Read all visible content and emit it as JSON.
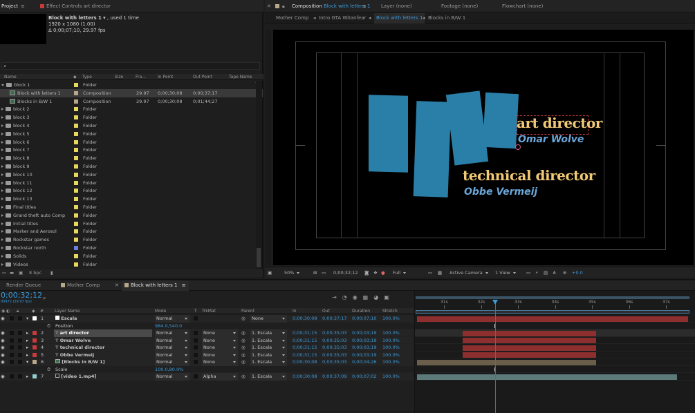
{
  "project_panel": {
    "tab_project": "Project",
    "tab_effect_controls": "Effect Controls art director",
    "comp_name": "Block with letters 1",
    "used": ", used 1 time",
    "dims": "1920 x 1080 (1.00)",
    "duration": "Δ 0;00;07;10, 29.97 fps",
    "search_glyph": "⌕",
    "headers": {
      "name": "Name",
      "type": "Type",
      "size": "Size",
      "fps": "Fra...",
      "in": "In Point",
      "out": "Out Point",
      "tape": "Tape Name"
    },
    "items": [
      {
        "name": "block 1",
        "type": "Folder",
        "color": "#e7d95e",
        "fps": "",
        "in": "",
        "out": "",
        "kind": "folder-open"
      },
      {
        "name": "Block with letters 1",
        "type": "Composition",
        "color": "#b8a88a",
        "fps": "29.97",
        "in": "0;00;30;08",
        "out": "0;00;37;17",
        "kind": "comp"
      },
      {
        "name": "Blocks in B/W 1",
        "type": "Composition",
        "color": "#b8a88a",
        "fps": "29.97",
        "in": "0;00;30;08",
        "out": "0;01;44;27",
        "kind": "comp"
      },
      {
        "name": "block 2",
        "type": "Folder",
        "color": "#e7d95e",
        "fps": "",
        "in": "",
        "out": "",
        "kind": "folder"
      },
      {
        "name": "block 3",
        "type": "Folder",
        "color": "#e7d95e",
        "fps": "",
        "in": "",
        "out": "",
        "kind": "folder"
      },
      {
        "name": "block 4",
        "type": "Folder",
        "color": "#e7d95e",
        "fps": "",
        "in": "",
        "out": "",
        "kind": "folder"
      },
      {
        "name": "block 5",
        "type": "Folder",
        "color": "#e7d95e",
        "fps": "",
        "in": "",
        "out": "",
        "kind": "folder"
      },
      {
        "name": "block 6",
        "type": "Folder",
        "color": "#e7d95e",
        "fps": "",
        "in": "",
        "out": "",
        "kind": "folder"
      },
      {
        "name": "block 7",
        "type": "Folder",
        "color": "#e7d95e",
        "fps": "",
        "in": "",
        "out": "",
        "kind": "folder"
      },
      {
        "name": "block 8",
        "type": "Folder",
        "color": "#e7d95e",
        "fps": "",
        "in": "",
        "out": "",
        "kind": "folder"
      },
      {
        "name": "block 9",
        "type": "Folder",
        "color": "#e7d95e",
        "fps": "",
        "in": "",
        "out": "",
        "kind": "folder"
      },
      {
        "name": "block 10",
        "type": "Folder",
        "color": "#e7d95e",
        "fps": "",
        "in": "",
        "out": "",
        "kind": "folder"
      },
      {
        "name": "block 11",
        "type": "Folder",
        "color": "#e7d95e",
        "fps": "",
        "in": "",
        "out": "",
        "kind": "folder"
      },
      {
        "name": "block 12",
        "type": "Folder",
        "color": "#e7d95e",
        "fps": "",
        "in": "",
        "out": "",
        "kind": "folder"
      },
      {
        "name": "block 13",
        "type": "Folder",
        "color": "#e7d95e",
        "fps": "",
        "in": "",
        "out": "",
        "kind": "folder"
      },
      {
        "name": "Final titles",
        "type": "Folder",
        "color": "#e7d95e",
        "fps": "",
        "in": "",
        "out": "",
        "kind": "folder"
      },
      {
        "name": "Grand theft auto Comp",
        "type": "Folder",
        "color": "#e7d95e",
        "fps": "",
        "in": "",
        "out": "",
        "kind": "folder"
      },
      {
        "name": "Initial titles",
        "type": "Folder",
        "color": "#e7d95e",
        "fps": "",
        "in": "",
        "out": "",
        "kind": "folder"
      },
      {
        "name": "Marker and Aerosol",
        "type": "Folder",
        "color": "#e7d95e",
        "fps": "",
        "in": "",
        "out": "",
        "kind": "folder"
      },
      {
        "name": "Rockstar games",
        "type": "Folder",
        "color": "#e7d95e",
        "fps": "",
        "in": "",
        "out": "",
        "kind": "folder"
      },
      {
        "name": "Rockstar north",
        "type": "Folder",
        "color": "#6b7fe0",
        "fps": "",
        "in": "",
        "out": "",
        "kind": "folder"
      },
      {
        "name": "Solids",
        "type": "Folder",
        "color": "#e7d95e",
        "fps": "",
        "in": "",
        "out": "",
        "kind": "folder"
      },
      {
        "name": "Videos",
        "type": "Folder",
        "color": "#e7d95e",
        "fps": "",
        "in": "",
        "out": "",
        "kind": "folder"
      }
    ],
    "bpc": "8 bpc"
  },
  "comp_panel": {
    "tab_label": "Composition",
    "tab_comp": "Block with letters 1",
    "tab_layer": "Layer (none)",
    "tab_footage": "Footage (none)",
    "tab_flowchart": "Flowchart (none)",
    "subtabs": [
      "Mother Comp",
      "Intro GTA Witanfear",
      "Block with letters 1",
      "Blocks in B/W 1"
    ],
    "title1": "art director",
    "name1": "Omar Wolve",
    "title2": "technical director",
    "name2": "Obbe Vermeij",
    "zoom": "50%",
    "timecode": "0;00;32;12",
    "resolution": "Full",
    "camera": "Active Camera",
    "views": "1 View",
    "exposure": "+0.0"
  },
  "timeline": {
    "tabs": [
      "Render Queue",
      "Mother Comp",
      "Block with letters 1"
    ],
    "current_time": "0;00;32;12",
    "frames": "00972 (29.97 fps)",
    "headers": {
      "layer": "Layer Name",
      "mode": "Mode",
      "t": "T",
      "trkmat": "TrkMat",
      "parent": "Parent",
      "in": "In",
      "out": "Out",
      "duration": "Duration",
      "stretch": "Stretch"
    },
    "ruler": [
      "31s",
      "32s",
      "33s",
      "34s",
      "35s",
      "36s",
      "37s"
    ],
    "rows": [
      {
        "num": "1",
        "name": "Escala",
        "color": "#ffffff",
        "mode": "Normal",
        "trkmat": "",
        "parent": "None",
        "in": "0;00;30;08",
        "out": "0;00;37;17",
        "dur": "0;00;07;10",
        "stretch": "100.0%",
        "kind": "layer",
        "expanded": true
      },
      {
        "num": "",
        "name": "Position",
        "value": "984.0,540.0",
        "kind": "prop"
      },
      {
        "num": "2",
        "name": "art director",
        "color": "#c83b3b",
        "mode": "Normal",
        "trkmat": "None",
        "parent": "1. Escala",
        "in": "0;00;31;15",
        "out": "0;00;35;03",
        "dur": "0;00;03;19",
        "stretch": "100.0%",
        "kind": "text",
        "selected": true
      },
      {
        "num": "3",
        "name": "Omar Wolve",
        "color": "#c83b3b",
        "mode": "Normal",
        "trkmat": "None",
        "parent": "1. Escala",
        "in": "0;00;31;15",
        "out": "0;00;35;03",
        "dur": "0;00;03;19",
        "stretch": "100.0%",
        "kind": "text"
      },
      {
        "num": "4",
        "name": "technical director",
        "color": "#c83b3b",
        "mode": "Normal",
        "trkmat": "None",
        "parent": "1. Escala",
        "in": "0;00;31;15",
        "out": "0;00;35;03",
        "dur": "0;00;03;19",
        "stretch": "100.0%",
        "kind": "text"
      },
      {
        "num": "5",
        "name": "Obbe Vermeij",
        "color": "#c83b3b",
        "mode": "Normal",
        "trkmat": "None",
        "parent": "1. Escala",
        "in": "0;00;31;15",
        "out": "0;00;35;03",
        "dur": "0;00;03;19",
        "stretch": "100.0%",
        "kind": "text"
      },
      {
        "num": "6",
        "name": "[Blocks in B/W 1]",
        "color": "#b8a88a",
        "mode": "Normal",
        "trkmat": "None",
        "parent": "1. Escala",
        "in": "0;00;30;08",
        "out": "0;00;35;03",
        "dur": "0;00;04;26",
        "stretch": "100.0%",
        "kind": "comp",
        "expanded": true
      },
      {
        "num": "",
        "name": "Scale",
        "value": "100.0,80.0%",
        "kind": "prop"
      },
      {
        "num": "7",
        "name": "[video 1.mp4]",
        "color": "#8fd0d0",
        "mode": "Normal",
        "trkmat": "Alpha",
        "parent": "1. Escala",
        "in": "0;00;30;08",
        "out": "0;00;37;09",
        "dur": "0;00;07;02",
        "stretch": "100.0%",
        "kind": "footage"
      }
    ]
  },
  "colors": {
    "accent": "#3b9bdc",
    "block": "#2a7fa8",
    "title": "#f2c976",
    "name": "#6aa6d8",
    "playhead": "#d23a3a"
  }
}
